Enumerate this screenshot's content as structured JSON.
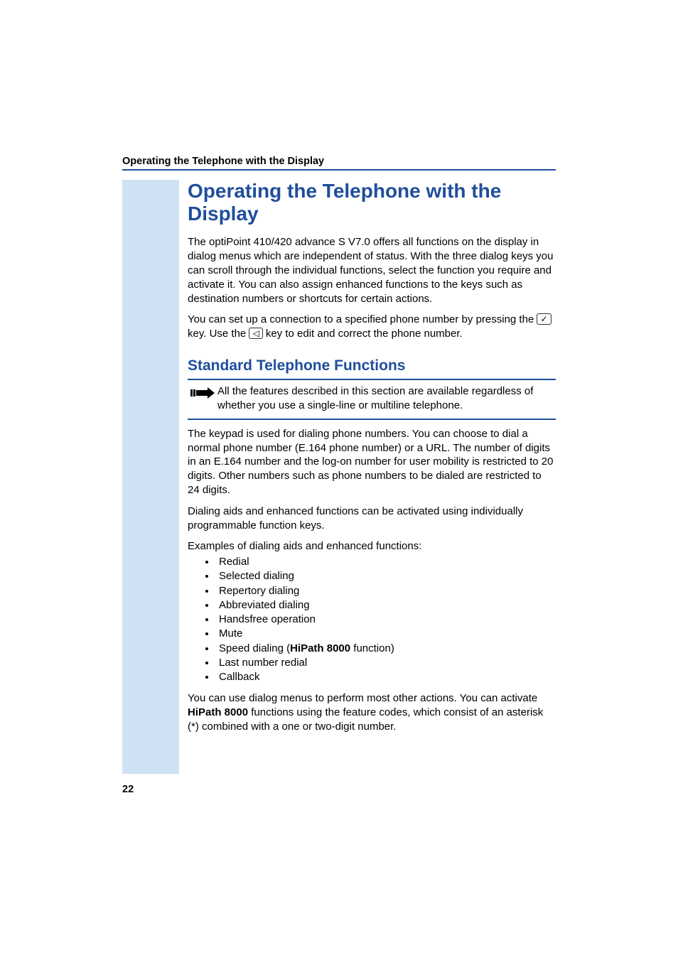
{
  "running_header": "Operating the Telephone with the Display",
  "page_number": "22",
  "h1": "Operating the Telephone with the Display",
  "intro_para": "The optiPoint 410/420 advance S V7.0 offers all functions on the display in dialog menus which are independent of status. With the three dialog keys you can scroll through the individual functions, select the function you require and activate it. You can also assign enhanced functions to the keys such as destination numbers or shortcuts for certain actions.",
  "setup_sentence_a": "You can set up a connection to a specified phone number by pressing the ",
  "setup_sentence_b": " key. Use the ",
  "setup_sentence_c": " key to edit and correct the phone number.",
  "key_ok_glyph": "✓",
  "key_back_glyph": "◁",
  "h2": "Standard Telephone Functions",
  "note_text": "All the features described in this section are available regardless of whether you use a single-line or multiline telephone.",
  "keypad_para": "The keypad is used for dialing phone numbers. You can choose to dial a normal phone number (E.164 phone number) or a URL. The number of digits in an E.164 number and the log-on number for user mobility is restricted to 20 digits. Other numbers such as phone numbers to be dialed are restricted to 24 digits.",
  "aids_para": "Dialing aids and enhanced functions can be activated using individually programmable function keys.",
  "examples_intro": "Examples of dialing aids and enhanced functions:",
  "examples": [
    "Redial",
    "Selected dialing",
    "Repertory dialing",
    "Abbreviated dialing",
    "Handsfree operation",
    "Mute",
    {
      "pre": "Speed dialing (",
      "bold": "HiPath 8000",
      "post": " function)"
    },
    "Last number redial",
    "Callback"
  ],
  "closing_a": "You can use dialog menus to perform most other actions. You can activate ",
  "closing_bold": "HiPath 8000",
  "closing_b": " functions using the feature codes, which consist of an asterisk (*) combined with a one or two-digit number."
}
